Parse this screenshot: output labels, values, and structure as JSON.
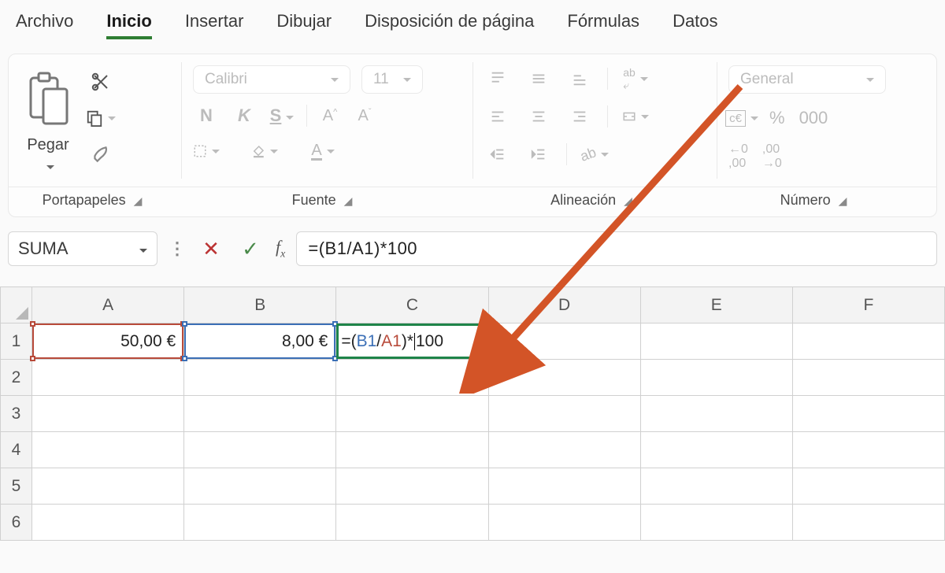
{
  "menu": {
    "items": [
      "Archivo",
      "Inicio",
      "Insertar",
      "Dibujar",
      "Disposición de página",
      "Fórmulas",
      "Datos"
    ],
    "active": "Inicio"
  },
  "ribbon": {
    "clipboard": {
      "label": "Portapapeles",
      "paste": "Pegar"
    },
    "font": {
      "label": "Fuente",
      "family": "Calibri",
      "size": "11",
      "bold": "N",
      "italic": "K",
      "underline": "S",
      "grow": "A",
      "shrink": "A"
    },
    "alignment": {
      "label": "Alineación"
    },
    "number": {
      "label": "Número",
      "format": "General",
      "percent": "%",
      "thousands": "000",
      "inc": ",00",
      "dec": ",00"
    }
  },
  "formulaBar": {
    "nameBox": "SUMA",
    "formula": "=(B1/A1)*100"
  },
  "sheet": {
    "columns": [
      "A",
      "B",
      "C",
      "D",
      "E",
      "F"
    ],
    "rows": [
      "1",
      "2",
      "3",
      "4",
      "5",
      "6"
    ],
    "a1": "50,00 €",
    "b1": "8,00 €",
    "c1_prefix": "=(",
    "c1_b": "B1",
    "c1_slash": "/",
    "c1_a": "A1",
    "c1_mid": ")*",
    "c1_tail": "100"
  },
  "colors": {
    "refA": "#b84a3a",
    "refB": "#3b6fb6",
    "active": "#1e8449",
    "arrow": "#d35427"
  }
}
